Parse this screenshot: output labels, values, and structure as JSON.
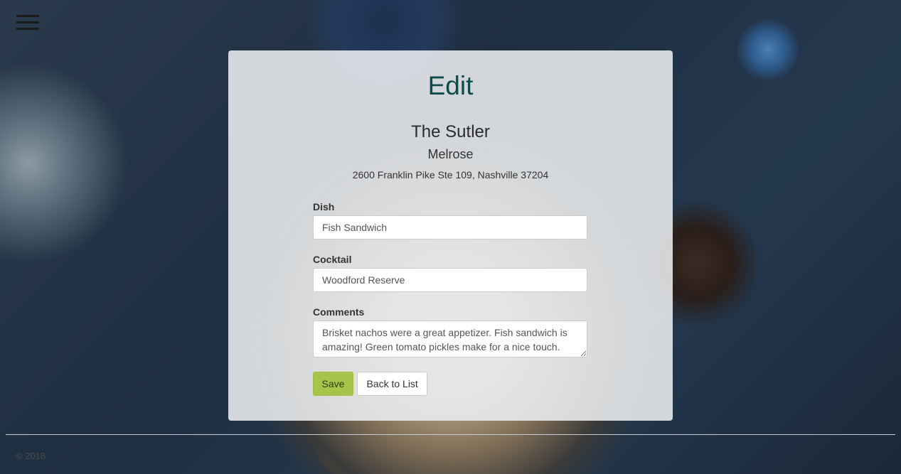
{
  "nav": {
    "menu_icon": "hamburger-menu-icon"
  },
  "page": {
    "title": "Edit"
  },
  "restaurant": {
    "name": "The Sutler",
    "neighborhood": "Melrose",
    "address": "2600 Franklin Pike Ste 109, Nashville 37204"
  },
  "form": {
    "dish_label": "Dish",
    "dish_value": "Fish Sandwich",
    "cocktail_label": "Cocktail",
    "cocktail_value": "Woodford Reserve",
    "comments_label": "Comments",
    "comments_value": "Brisket nachos were a great appetizer. Fish sandwich is amazing! Green tomato pickles make for a nice touch. Get the brisket nachos and chill out in front of the"
  },
  "buttons": {
    "save_label": "Save",
    "back_label": "Back to List"
  },
  "footer": {
    "text": "© 2018"
  },
  "colors": {
    "title": "#0d4a4a",
    "save_button": "#a6c34a",
    "card_bg": "#eceef0"
  }
}
